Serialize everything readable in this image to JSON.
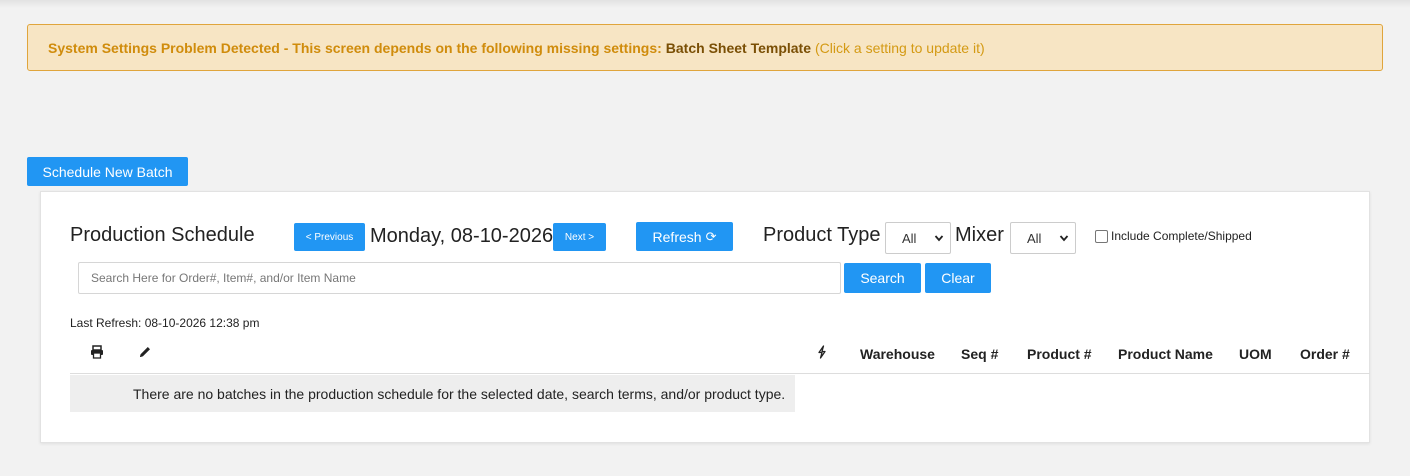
{
  "alert": {
    "message": "System Settings Problem Detected - This screen depends on the following missing settings:",
    "setting_link": "Batch Sheet Template",
    "hint": "(Click a setting to update it)",
    "colors": {
      "background": "#f7e5c4",
      "border": "#e0a53c",
      "text": "#d49a14"
    }
  },
  "actions": {
    "schedule_new_batch": "Schedule New Batch"
  },
  "schedule": {
    "title": "Production Schedule",
    "previous_label": "< Previous",
    "date": "Monday, 08-10-2026",
    "next_label": "Next >",
    "refresh_label": "Refresh",
    "refresh_icon": "⟳",
    "product_type_label": "Product Type",
    "product_type_selected": "All",
    "mixer_label": "Mixer",
    "mixer_selected": "All",
    "include_complete_label": "Include Complete/Shipped",
    "include_complete_checked": false
  },
  "search": {
    "placeholder": "Search Here for Order#, Item#, and/or Item Name",
    "search_label": "Search",
    "clear_label": "Clear"
  },
  "last_refresh": "Last Refresh: 08-10-2026 12:38 pm",
  "table": {
    "icons": [
      "print-icon",
      "edit-icon",
      "lightning-icon"
    ],
    "columns": [
      "Warehouse",
      "Seq #",
      "Product #",
      "Product Name",
      "UOM",
      "Order #"
    ],
    "empty_message": "There are no batches in the production schedule for the selected date, search terms, and/or product type."
  },
  "accent_color": "#2196f3"
}
